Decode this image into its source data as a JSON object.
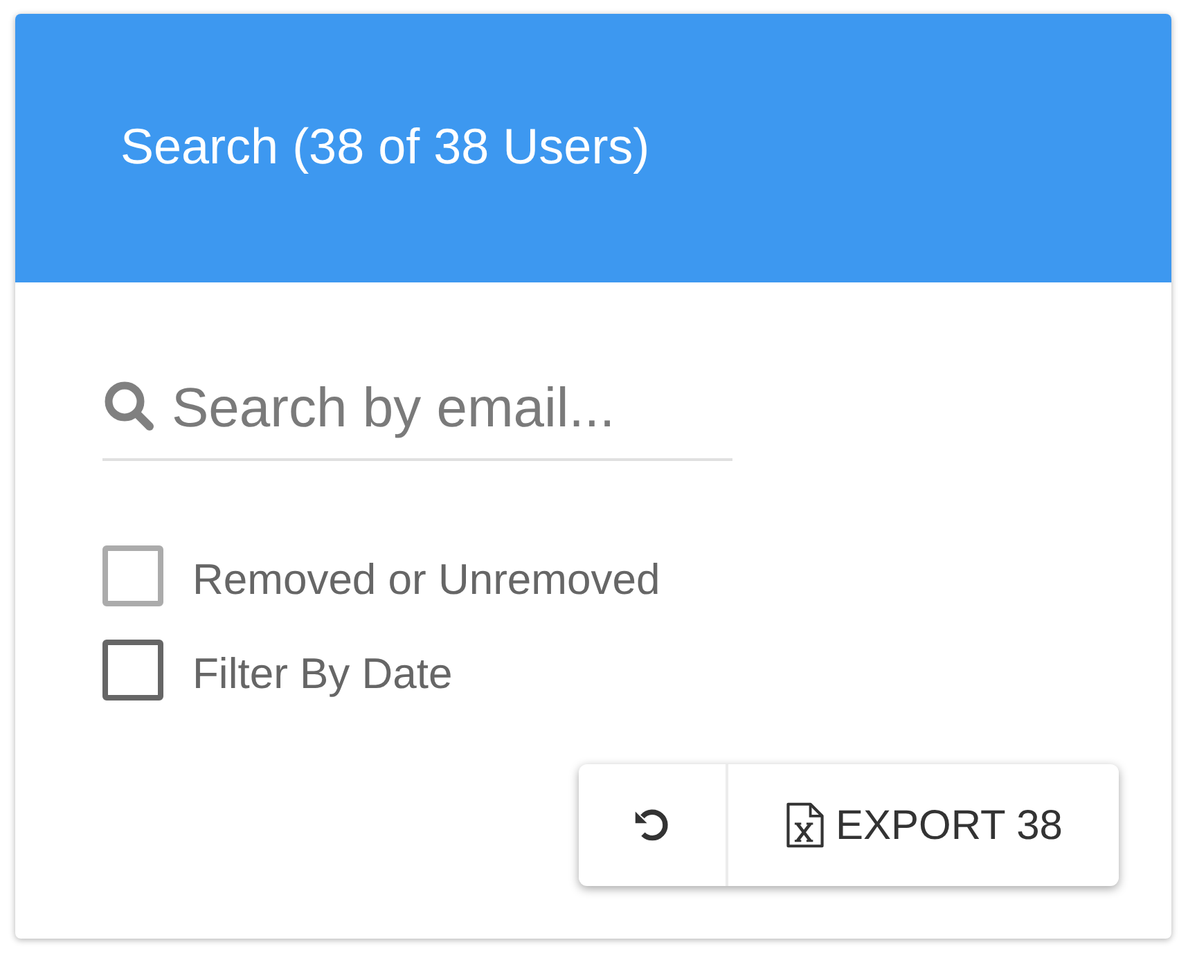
{
  "header": {
    "title": "Search (38 of 38 Users)"
  },
  "search": {
    "placeholder": "Search by email..."
  },
  "filters": [
    {
      "label": "Removed or Unremoved",
      "checked": false,
      "disabled": true
    },
    {
      "label": "Filter By Date",
      "checked": false,
      "disabled": false
    }
  ],
  "actions": {
    "export_label": "EXPORT 38"
  }
}
